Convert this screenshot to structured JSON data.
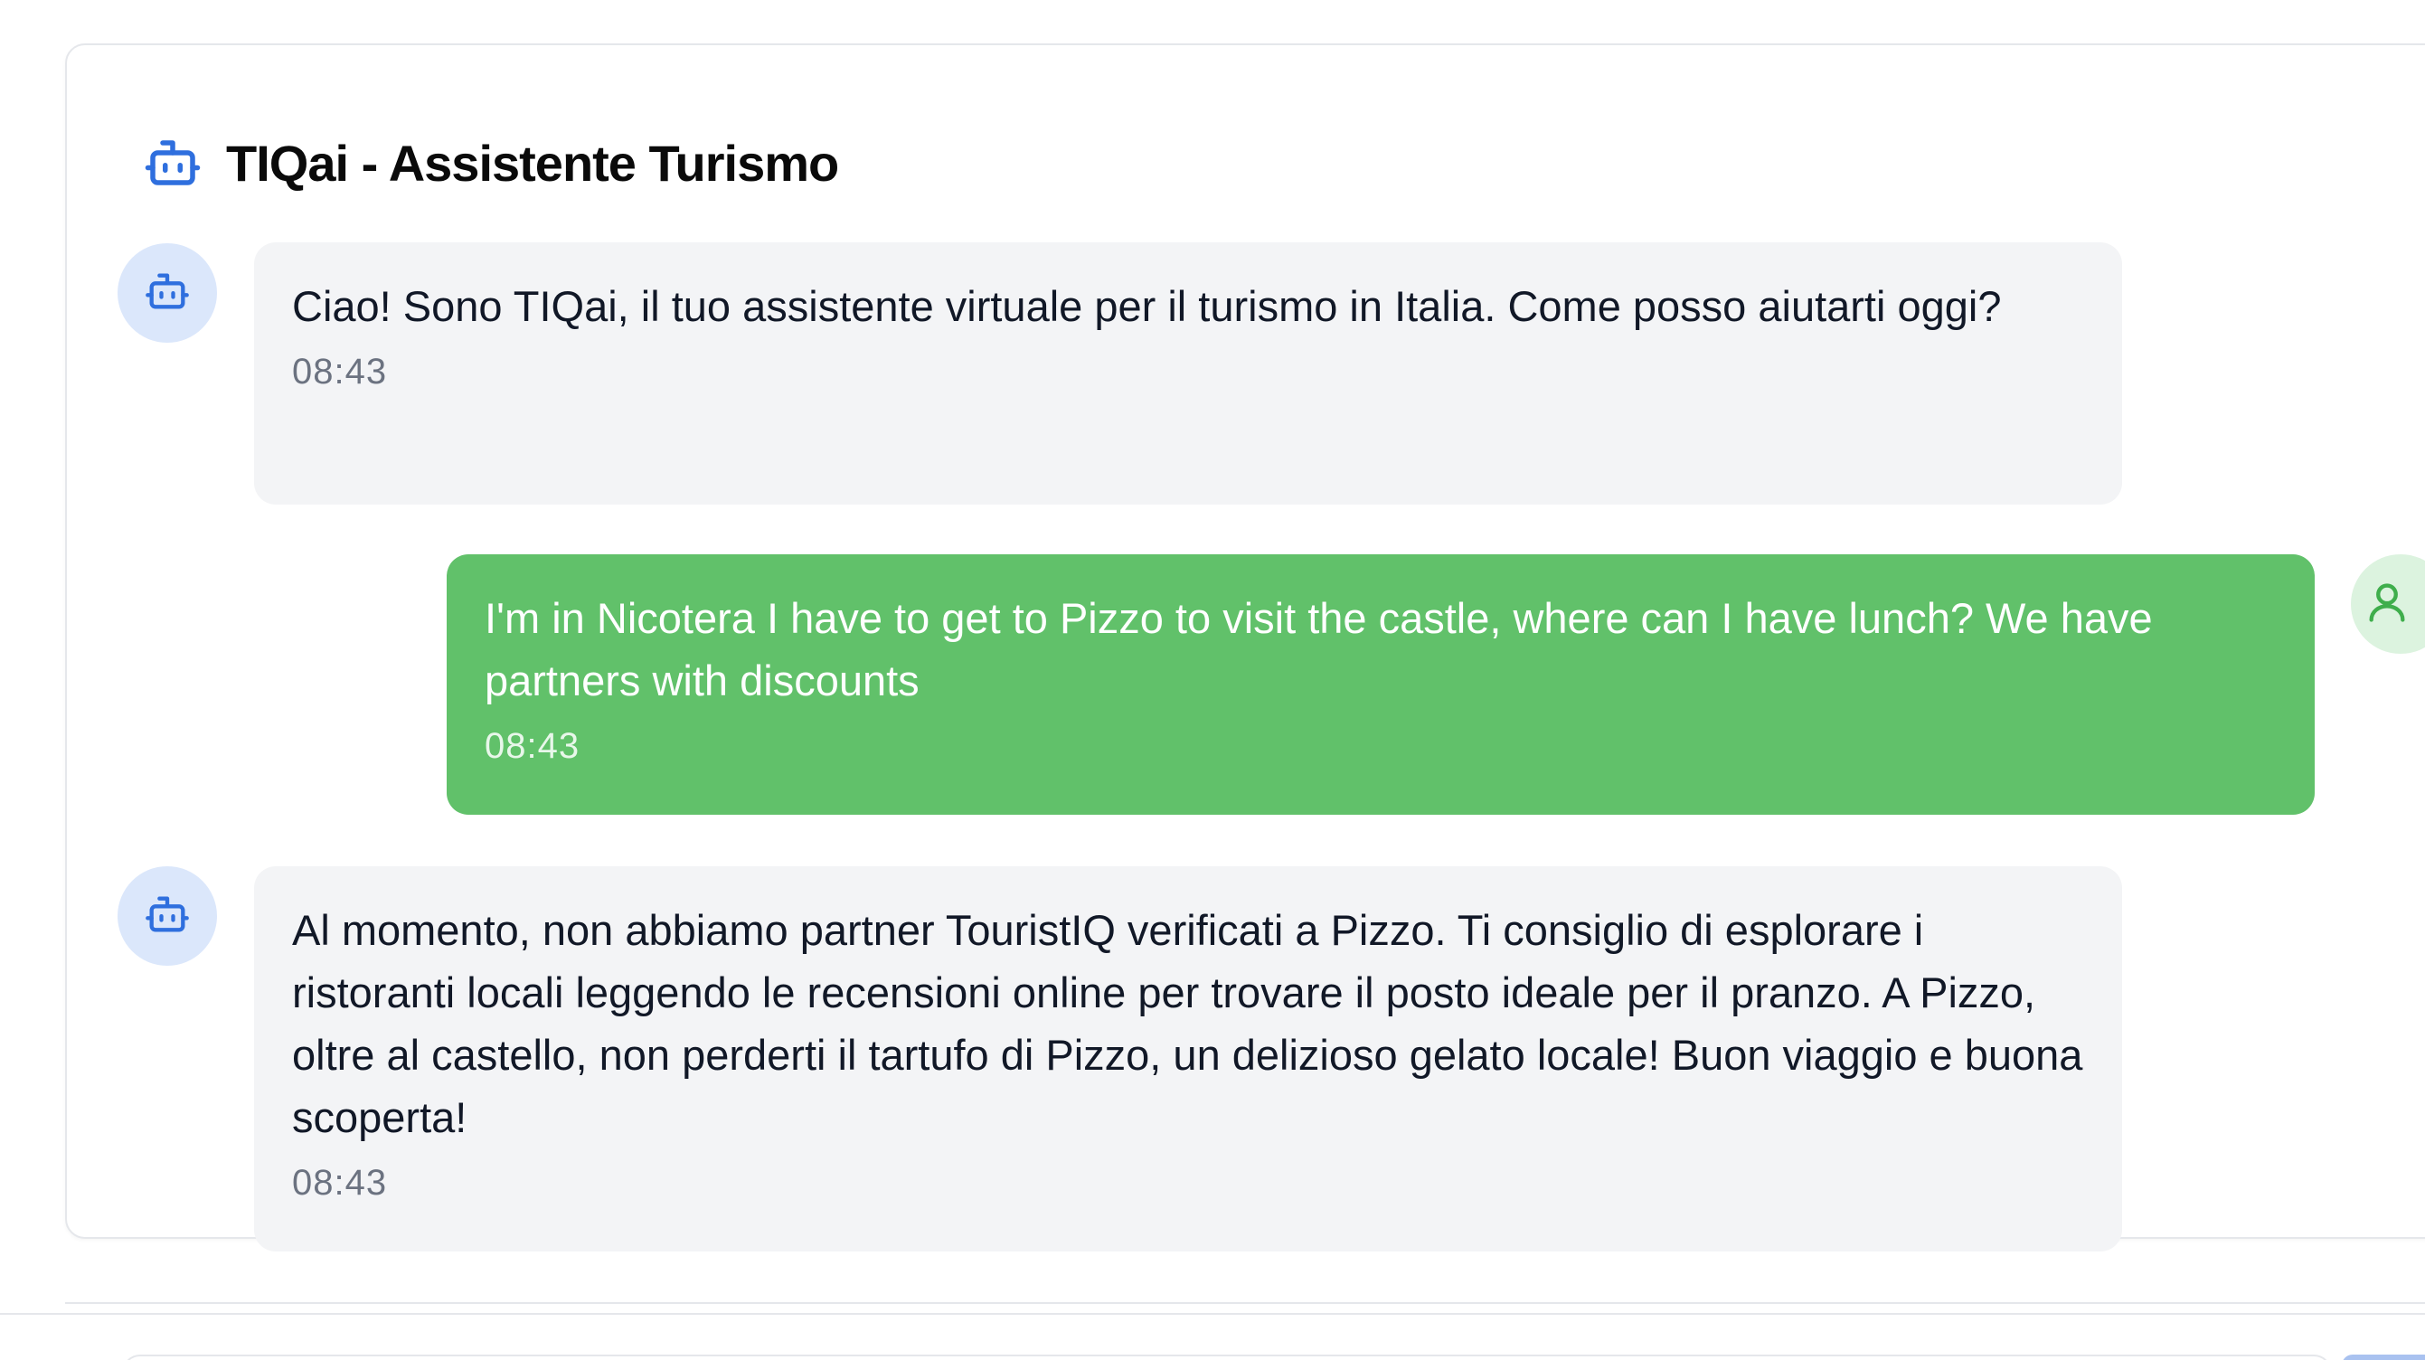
{
  "header": {
    "title": "TIQai - Assistente Turismo",
    "icon": "bot-icon",
    "accent_color": "#2f6fde"
  },
  "messages": [
    {
      "role": "bot",
      "text": "Ciao! Sono TIQai, il tuo assistente virtuale per il turismo in Italia. Come posso aiutarti oggi?",
      "time": "08:43",
      "avatar_icon": "bot-icon"
    },
    {
      "role": "user",
      "text": "I'm in Nicotera I have to get to Pizzo to visit the castle, where can I have lunch? We have partners with discounts",
      "time": "08:43",
      "avatar_icon": "user-icon",
      "bubble_color": "#61c16a"
    },
    {
      "role": "bot",
      "text": "Al momento, non abbiamo partner TouristIQ verificati a Pizzo. Ti consiglio di esplorare i ristoranti locali leggendo le recensioni online per trovare il posto ideale per il pranzo. A Pizzo, oltre al castello, non perderti il tartufo di Pizzo, un delizioso gelato locale! Buon viaggio e buona scoperta!",
      "time": "08:43",
      "avatar_icon": "bot-icon"
    }
  ]
}
